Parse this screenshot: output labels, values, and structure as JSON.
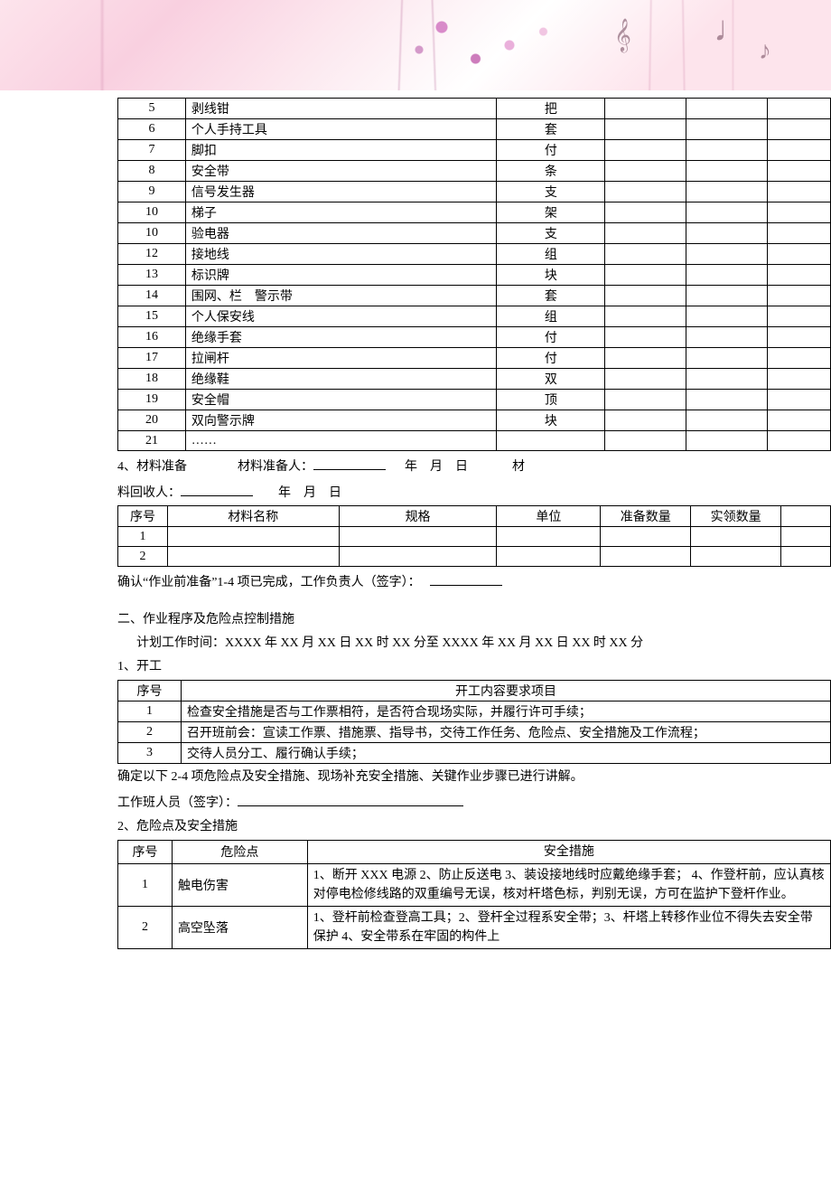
{
  "tools": {
    "rows": [
      {
        "no": "5",
        "name": "剥线钳",
        "unit": "把"
      },
      {
        "no": "6",
        "name": "个人手持工具",
        "unit": "套"
      },
      {
        "no": "7",
        "name": "脚扣",
        "unit": "付"
      },
      {
        "no": "8",
        "name": "安全带",
        "unit": "条"
      },
      {
        "no": "9",
        "name": "信号发生器",
        "unit": "支"
      },
      {
        "no": "10",
        "name": "梯子",
        "unit": "架"
      },
      {
        "no": "10",
        "name": "验电器",
        "unit": "支"
      },
      {
        "no": "12",
        "name": "接地线",
        "unit": "组"
      },
      {
        "no": "13",
        "name": "标识牌",
        "unit": "块"
      },
      {
        "no": "14",
        "name": "围网、栏　警示带",
        "unit": "套"
      },
      {
        "no": "15",
        "name": "个人保安线",
        "unit": "组"
      },
      {
        "no": "16",
        "name": "绝缘手套",
        "unit": "付"
      },
      {
        "no": "17",
        "name": "拉闸杆",
        "unit": "付"
      },
      {
        "no": "18",
        "name": "绝缘鞋",
        "unit": "双"
      },
      {
        "no": "19",
        "name": "安全帽",
        "unit": "顶"
      },
      {
        "no": "20",
        "name": "双向警示牌",
        "unit": "块"
      },
      {
        "no": "21",
        "name": "……",
        "unit": ""
      }
    ]
  },
  "materials": {
    "heading": "4、材料准备",
    "preparer_label": "材料准备人：",
    "date_label_1": "年　月　日",
    "recycler_label": "料回收人：",
    "recycler_prefix": "材",
    "date_label_2": "年　月　日",
    "headers": {
      "no": "序号",
      "name": "材料名称",
      "spec": "规格",
      "unit": "单位",
      "prep_qty": "准备数量",
      "recv_qty": "实领数量",
      "extra": ""
    },
    "rows": [
      {
        "no": "1"
      },
      {
        "no": "2"
      }
    ]
  },
  "confirm_prep": {
    "text": "确认“作业前准备”1-4 项已完成，工作负责人（签字）：",
    "blank": "　　　　　"
  },
  "section2": {
    "title": "二、作业程序及危险点控制措施",
    "plan_time": "计划工作时间：XXXX 年 XX 月 XX 日 XX 时 XX 分至 XXXX 年 XX 月 XX 日 XX 时 XX 分"
  },
  "kaigong": {
    "heading": "1、开工",
    "headers": {
      "no": "序号",
      "item": "开工内容要求项目"
    },
    "rows": [
      {
        "no": "1",
        "item": "检查安全措施是否与工作票相符，是否符合现场实际，并履行许可手续；"
      },
      {
        "no": "2",
        "item": "召开班前会：宣读工作票、措施票、指导书，交待工作任务、危险点、安全措施及工作流程；"
      },
      {
        "no": "3",
        "item": "交待人员分工、履行确认手续；"
      }
    ]
  },
  "confirm_kaigong": {
    "line1": "确定以下 2-4 项危险点及安全措施、现场补充安全措施、关键作业步骤已进行讲解。",
    "line2": "工作班人员（签字）："
  },
  "risk": {
    "heading": "2、危险点及安全措施",
    "headers": {
      "no": "序号",
      "point": "危险点",
      "measure": "安全措施"
    },
    "rows": [
      {
        "no": "1",
        "point": "触电伤害",
        "measure": "1、断开 XXX 电源 2、防止反送电 3、装设接地线时应戴绝缘手套；  4、作登杆前，应认真核对停电检修线路的双重编号无误，核对杆塔色标，判别无误，方可在监护下登杆作业。"
      },
      {
        "no": "2",
        "point": "高空坠落",
        "measure": "1、登杆前检查登高工具；2、登杆全过程系安全带；3、杆塔上转移作业位不得失去安全带保护 4、安全带系在牢固的构件上"
      }
    ]
  }
}
